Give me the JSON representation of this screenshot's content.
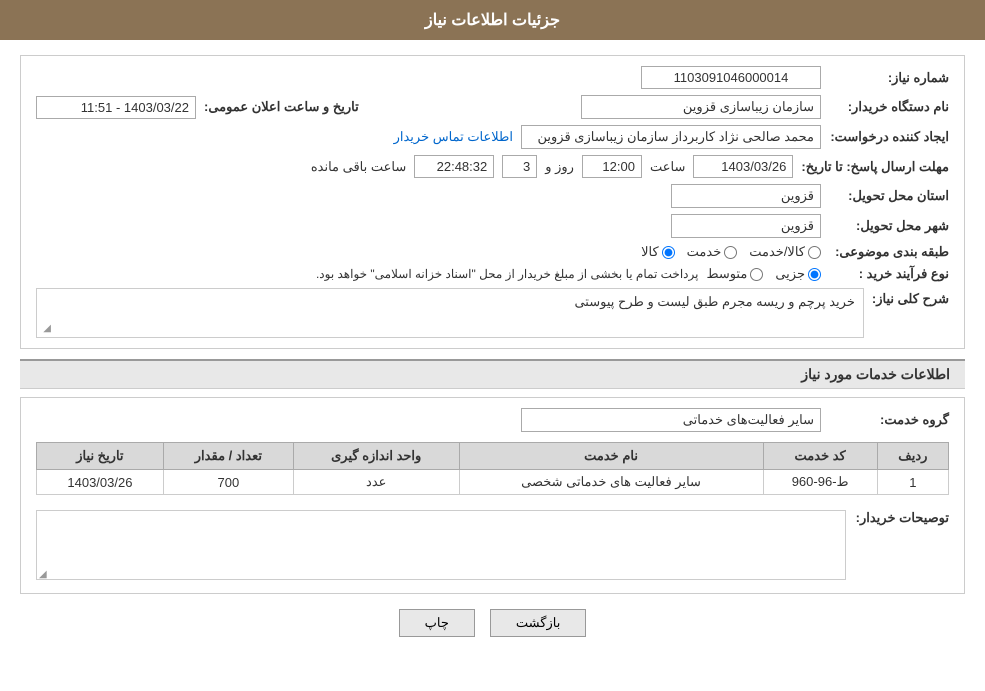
{
  "header": {
    "title": "جزئیات اطلاعات نیاز"
  },
  "form": {
    "shomara_niaz_label": "شماره نیاز:",
    "shomara_niaz_value": "1103091046000014",
    "nam_dastgah_label": "نام دستگاه خریدار:",
    "nam_dastgah_value": "سازمان زیباسازی قزوین",
    "tarix_saaat_label": "تاریخ و ساعت اعلان عمومی:",
    "tarix_saaat_value": "1403/03/22 - 11:51",
    "ijad_label": "ایجاد کننده درخواست:",
    "ijad_value": "محمد صالحی نژاد کاربرداز سازمان زیباسازی قزوین",
    "ejad_link": "اطلاعات تماس خریدار",
    "mohlet_label": "مهلت ارسال پاسخ: تا تاریخ:",
    "mohlet_date": "1403/03/26",
    "mohlet_saaat": "12:00",
    "mohlet_roz": "3",
    "mohlet_remaining": "22:48:32",
    "mohlet_remaining_label": "ساعت باقی مانده",
    "roz_label": "روز و",
    "saaat_label": "ساعت",
    "ostan_label": "استان محل تحویل:",
    "ostan_value": "قزوین",
    "shahr_label": "شهر محل تحویل:",
    "shahr_value": "قزوین",
    "tabaqe_label": "طبقه بندی موضوعی:",
    "kala_label": "کالا",
    "khedmat_label": "خدمت",
    "kala_khedmat_label": "کالا/خدمت",
    "nooe_farayand_label": "نوع فرآیند خرید :",
    "jozei_label": "جزیی",
    "motavaset_label": "متوسط",
    "farayand_desc": "پرداخت تمام یا بخشی از مبلغ خریدار از محل \"اسناد خزانه اسلامی\" خواهد بود.",
    "sharh_label": "شرح کلی نیاز:",
    "sharh_value": "خرید پرچم و ریسه مجرم طبق لیست و طرح پیوستی",
    "khadamat_section_title": "اطلاعات خدمات مورد نیاز",
    "goroh_label": "گروه خدمت:",
    "goroh_value": "سایر فعالیت‌های خدماتی",
    "table": {
      "headers": [
        "ردیف",
        "کد خدمت",
        "نام خدمت",
        "واحد اندازه گیری",
        "تعداد / مقدار",
        "تاریخ نیاز"
      ],
      "rows": [
        {
          "radif": "1",
          "kod": "ط-96-960",
          "nam": "سایر فعالیت های خدماتی شخصی",
          "vahed": "عدد",
          "tedad": "700",
          "tarix": "1403/03/26"
        }
      ]
    },
    "tosif_label": "توصیحات خریدار:",
    "back_btn": "بازگشت",
    "print_btn": "چاپ"
  }
}
